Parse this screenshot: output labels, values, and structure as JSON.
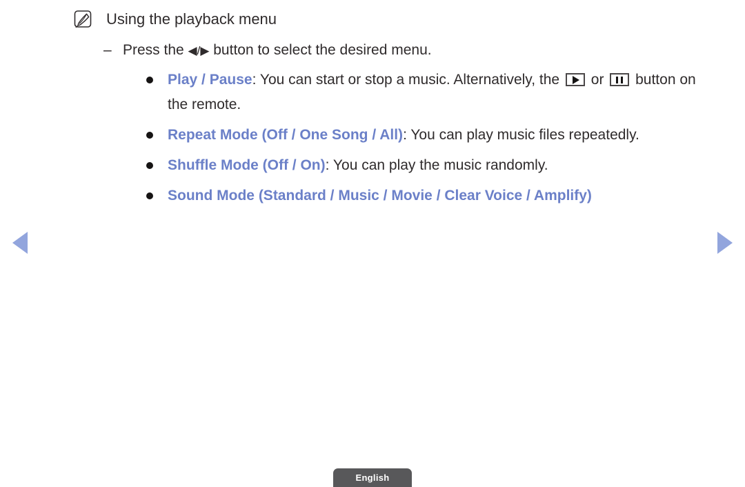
{
  "note": {
    "icon": "note-pencil-icon",
    "title": "Using the playback menu"
  },
  "instruction": {
    "dash": "–",
    "before_arrows": "Press the ",
    "arrows": "◀/▶",
    "after_arrows": " button to select the desired menu."
  },
  "bullets": [
    {
      "keyword": "Play / Pause",
      "text_before_play_icon": ": You can start or stop a music. Alternatively, the ",
      "play_icon": "play-key-icon",
      "text_between_icons": " or ",
      "pause_icon": "pause-key-icon",
      "text_after_pause_icon": " button on the remote."
    },
    {
      "keyword": "Repeat Mode (Off / One Song / All)",
      "text": ": You can play music files repeatedly."
    },
    {
      "keyword": "Shuffle Mode (Off / On)",
      "text": ": You can play the music randomly."
    },
    {
      "keyword": "Sound Mode (Standard / Music / Movie / Clear Voice / Amplify)",
      "text": ""
    }
  ],
  "navigation": {
    "prev_icon": "arrow-left-icon",
    "next_icon": "arrow-right-icon"
  },
  "language_button": {
    "label": "English"
  },
  "colors": {
    "keyword_blue": "#6b80c8",
    "nav_arrow_blue": "#92a5dd",
    "body_text": "#2f2b2c",
    "button_bg": "#58585a"
  }
}
